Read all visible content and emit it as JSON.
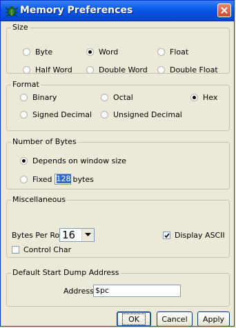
{
  "window": {
    "title": "Memory Preferences",
    "close_icon": "close-icon",
    "app_icon": "bug-icon"
  },
  "size": {
    "label": "Size",
    "options": [
      "Byte",
      "Word",
      "Float",
      "Half Word",
      "Double Word",
      "Double Float"
    ],
    "selected": "Word"
  },
  "format": {
    "label": "Format",
    "options": [
      "Binary",
      "Octal",
      "Hex",
      "Signed Decimal",
      "Unsigned Decimal"
    ],
    "selected": "Hex"
  },
  "bytes": {
    "label": "Number of Bytes",
    "depends_label": "Depends on window size",
    "fixed_label": "Fixed",
    "fixed_value": "128",
    "fixed_suffix": "bytes",
    "selected": "Depends on window size"
  },
  "misc": {
    "label": "Miscellaneous",
    "bytes_per_row_label": "Bytes Per Row",
    "bytes_per_row_value": "16",
    "display_ascii_label": "Display ASCII",
    "display_ascii_checked": true,
    "control_char_label": "Control Char",
    "control_char_checked": false
  },
  "dump": {
    "label": "Default Start Dump Address",
    "address_label": "Address",
    "address_value": "$pc"
  },
  "buttons": {
    "ok": "OK",
    "cancel": "Cancel",
    "apply": "Apply"
  }
}
